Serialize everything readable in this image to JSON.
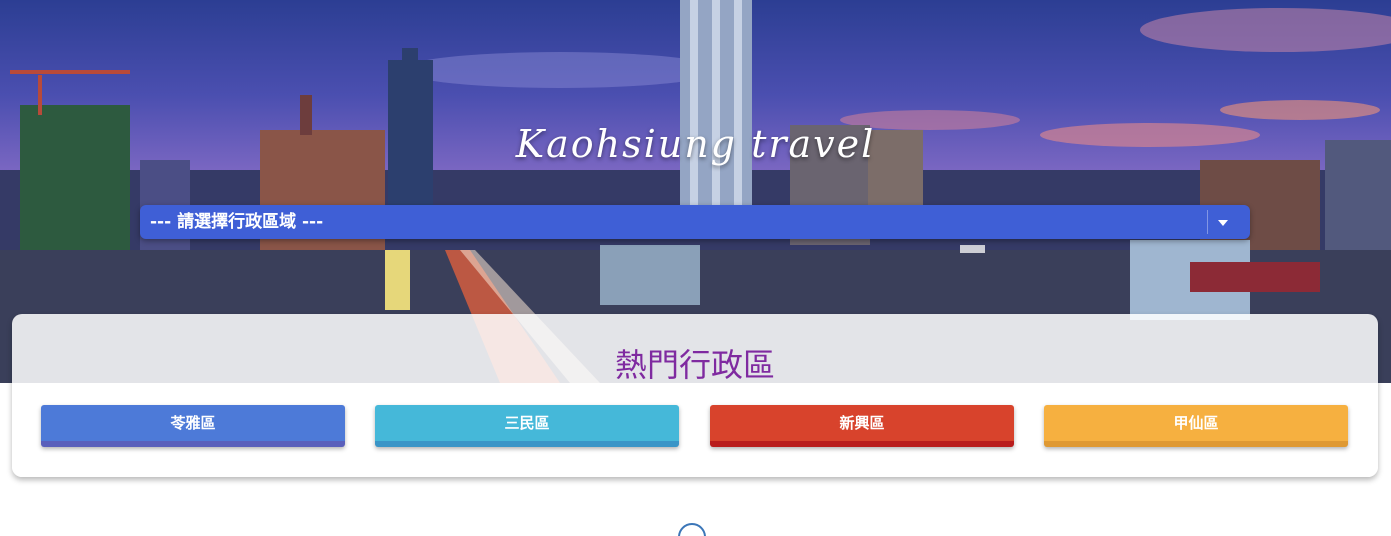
{
  "hero": {
    "title": "Kaohsiung travel"
  },
  "district_select": {
    "selected_label": "--- 請選擇行政區域 ---",
    "icon": "chevron-down-icon"
  },
  "popular": {
    "title": "熱門行政區",
    "buttons": [
      {
        "label": "苓雅區",
        "color": "#4d7ad8"
      },
      {
        "label": "三民區",
        "color": "#45b8d9"
      },
      {
        "label": "新興區",
        "color": "#d8432c"
      },
      {
        "label": "甲仙區",
        "color": "#f6b040"
      }
    ]
  },
  "scroll_icon": "scroll-down-circle-icon"
}
